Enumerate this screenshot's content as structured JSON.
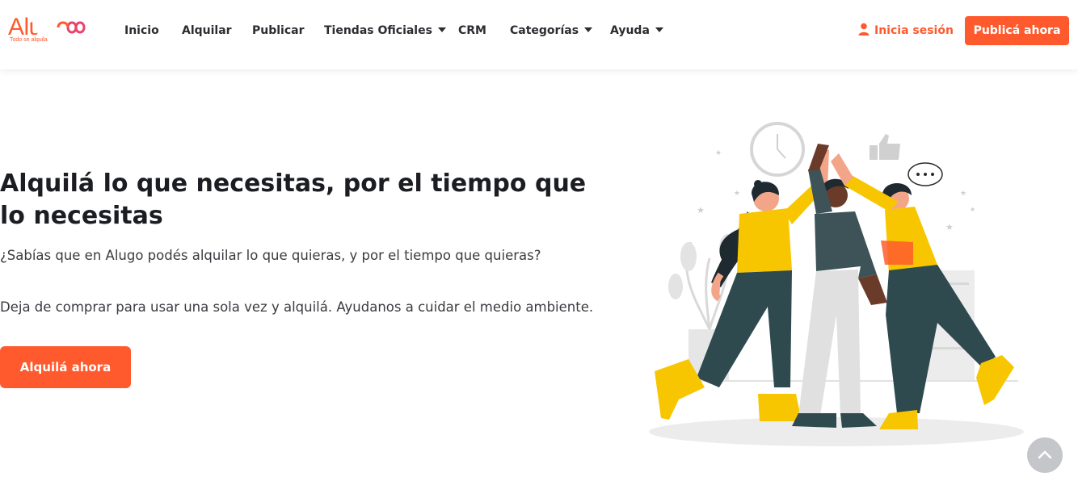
{
  "brand": {
    "name": "Alugo",
    "tagline": "Todo se alquila",
    "accent_color": "#ff5a2e"
  },
  "nav": {
    "items": [
      {
        "label": "Inicio",
        "has_dropdown": false
      },
      {
        "label": "Alquilar",
        "has_dropdown": false
      },
      {
        "label": "Publicar",
        "has_dropdown": false
      },
      {
        "label": "Tiendas Oficiales",
        "has_dropdown": true
      },
      {
        "label": "CRM",
        "has_dropdown": false
      },
      {
        "label": "Categorías",
        "has_dropdown": true
      },
      {
        "label": "Ayuda",
        "has_dropdown": true
      }
    ],
    "login_label": "Inicia sesión",
    "login_icon": "user-icon",
    "publish_label": "Publicá ahora"
  },
  "hero": {
    "title": "Alquilá lo que necesitas, por el tiempo que lo necesitas",
    "subtitle": "¿Sabías que en Alugo podés alquilar lo que quieras, y por el tiempo que quieras?",
    "subtitle2": "Deja de comprar para usar una sola vez y alquilá. Ayudanos a cuidar el medio ambiente.",
    "cta_label": "Alquilá ahora",
    "illustration": "three-people-high-five-illustration"
  },
  "scroll_top_icon": "chevron-up-icon"
}
